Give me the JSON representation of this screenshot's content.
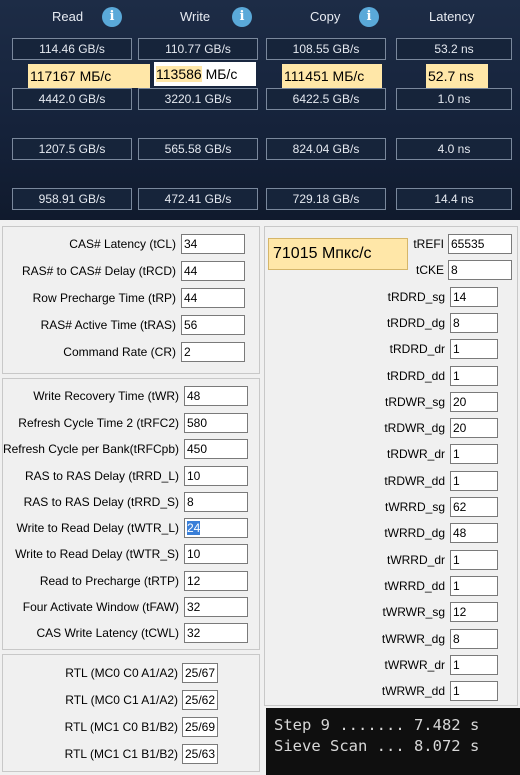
{
  "headers": [
    {
      "label": "Read",
      "icon": "info-icon"
    },
    {
      "label": "Write",
      "icon": "info-icon"
    },
    {
      "label": "Copy",
      "icon": "info-icon"
    },
    {
      "label": "Latency"
    }
  ],
  "info_glyph": "i",
  "bandwidth_rows": [
    [
      "114.46 GB/s",
      "110.77 GB/s",
      "108.55 GB/s",
      "53.2 ns"
    ],
    [
      "4442.0 GB/s",
      "3220.1 GB/s",
      "6422.5 GB/s",
      "1.0 ns"
    ],
    [
      "1207.5 GB/s",
      "565.58 GB/s",
      "824.04 GB/s",
      "4.0 ns"
    ],
    [
      "958.91 GB/s",
      "472.41 GB/s",
      "729.18 GB/s",
      "14.4 ns"
    ]
  ],
  "overlays": [
    {
      "value": "117167 МБ/с"
    },
    {
      "value": "113586",
      "unit": " МБ/с"
    },
    {
      "value": "111451 МБ/с"
    },
    {
      "value": "52.7 ns"
    }
  ],
  "primary_timings": [
    {
      "label": "CAS# Latency (tCL)",
      "value": "34"
    },
    {
      "label": "RAS# to CAS# Delay (tRCD)",
      "value": "44"
    },
    {
      "label": "Row Precharge Time (tRP)",
      "value": "44"
    },
    {
      "label": "RAS# Active Time (tRAS)",
      "value": "56"
    },
    {
      "label": "Command Rate (CR)",
      "value": "2"
    }
  ],
  "secondary_timings": [
    {
      "label": "Write Recovery Time (tWR)",
      "value": "48"
    },
    {
      "label": "Refresh Cycle Time 2 (tRFC2)",
      "value": "580"
    },
    {
      "label": "Refresh Cycle per Bank(tRFCpb)",
      "value": "450"
    },
    {
      "label": "RAS to RAS Delay (tRRD_L)",
      "value": "10"
    },
    {
      "label": "RAS to RAS Delay (tRRD_S)",
      "value": "8"
    },
    {
      "label": "Write to Read Delay (tWTR_L)",
      "value": "24",
      "selected": true
    },
    {
      "label": "Write to Read Delay (tWTR_S)",
      "value": "10"
    },
    {
      "label": "Read to Precharge (tRTP)",
      "value": "12"
    },
    {
      "label": "Four Activate Window (tFAW)",
      "value": "32"
    },
    {
      "label": "CAS Write Latency (tCWL)",
      "value": "32"
    }
  ],
  "rtl": [
    {
      "label": "RTL (MC0 C0 A1/A2)",
      "value": "25/67"
    },
    {
      "label": "RTL (MC0 C1 A1/A2)",
      "value": "25/62"
    },
    {
      "label": "RTL (MC1 C0 B1/B2)",
      "value": "25/69"
    },
    {
      "label": "RTL (MC1 C1 B1/B2)",
      "value": "25/63"
    }
  ],
  "right_timings": [
    {
      "label": "tREFI",
      "value": "65535"
    },
    {
      "label": "tCKE",
      "value": "8"
    },
    {
      "label": "tRDRD_sg",
      "value": "14"
    },
    {
      "label": "tRDRD_dg",
      "value": "8"
    },
    {
      "label": "tRDRD_dr",
      "value": "1"
    },
    {
      "label": "tRDRD_dd",
      "value": "1"
    },
    {
      "label": "tRDWR_sg",
      "value": "20"
    },
    {
      "label": "tRDWR_dg",
      "value": "20"
    },
    {
      "label": "tRDWR_dr",
      "value": "1"
    },
    {
      "label": "tRDWR_dd",
      "value": "1"
    },
    {
      "label": "tWRRD_sg",
      "value": "62"
    },
    {
      "label": "tWRRD_dg",
      "value": "48"
    },
    {
      "label": "tWRRD_dr",
      "value": "1"
    },
    {
      "label": "tWRRD_dd",
      "value": "1"
    },
    {
      "label": "tWRWR_sg",
      "value": "12"
    },
    {
      "label": "tWRWR_dg",
      "value": "8"
    },
    {
      "label": "tWRWR_dr",
      "value": "1"
    },
    {
      "label": "tWRWR_dd",
      "value": "1"
    }
  ],
  "mt_overlay": "71015 Мпкс/с",
  "terminal_lines": [
    "Step 9 ....... 7.482 s",
    "Sieve Scan ... 8.072 s"
  ],
  "colors": {
    "highlight": "#ffe7a8",
    "panel_bg": "#f0f0f0",
    "header_bg": "#1d2c46",
    "info_blue": "#5aa9d9",
    "selection": "#3a7fd8"
  }
}
